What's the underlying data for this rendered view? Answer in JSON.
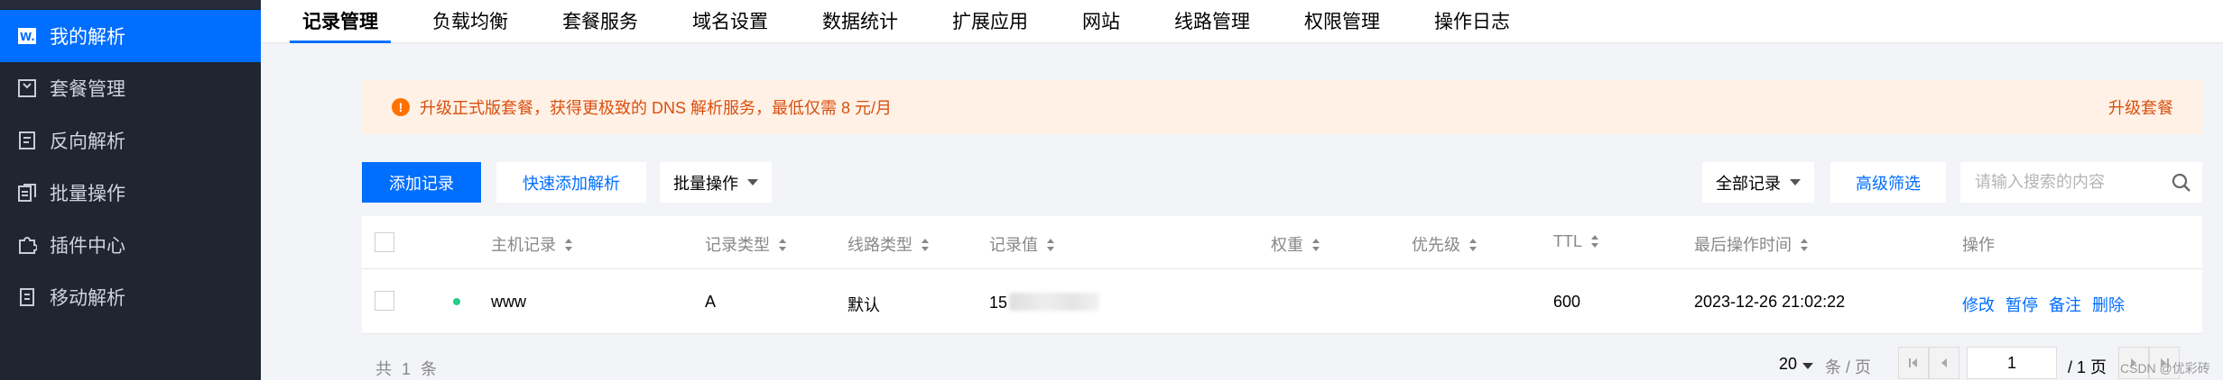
{
  "sidebar": {
    "items": [
      {
        "label": "我的解析",
        "icon": "dns-logo-icon",
        "active": true
      },
      {
        "label": "套餐管理",
        "icon": "package-icon",
        "active": false
      },
      {
        "label": "反向解析",
        "icon": "document-icon",
        "active": false
      },
      {
        "label": "批量操作",
        "icon": "stack-icon",
        "active": false
      },
      {
        "label": "插件中心",
        "icon": "puzzle-icon",
        "active": false
      },
      {
        "label": "移动解析",
        "icon": "mobile-doc-icon",
        "active": false
      }
    ]
  },
  "tabs": [
    "记录管理",
    "负载均衡",
    "套餐服务",
    "域名设置",
    "数据统计",
    "扩展应用",
    "网站",
    "线路管理",
    "权限管理",
    "操作日志"
  ],
  "alert": {
    "message": "升级正式版套餐，获得更极致的 DNS 解析服务，最低仅需 8 元/月",
    "action": "升级套餐",
    "icon": "warning-icon"
  },
  "toolbar": {
    "add_record": "添加记录",
    "quick_add": "快速添加解析",
    "batch": "批量操作",
    "filter_select": "全部记录",
    "advanced_filter": "高级筛选",
    "search_placeholder": "请输入搜索的内容"
  },
  "table": {
    "headers": {
      "host": "主机记录",
      "type": "记录类型",
      "line": "线路类型",
      "value": "记录值",
      "weight": "权重",
      "priority": "优先级",
      "ttl": "TTL",
      "last_modified": "最后操作时间",
      "actions": "操作"
    },
    "rows": [
      {
        "status": "enabled",
        "host": "www",
        "type": "A",
        "line": "默认",
        "value": "15",
        "weight": "",
        "priority": "",
        "ttl": "600",
        "last_modified": "2023-12-26 21:02:22",
        "actions": [
          "修改",
          "暂停",
          "备注",
          "删除"
        ]
      }
    ]
  },
  "footer": {
    "total": "共 1 条",
    "page_size": "20",
    "per_page": "条 / 页",
    "current_page": "1",
    "total_pages": "/ 1 页"
  },
  "watermark": "CSDN @优彩砖",
  "colors": {
    "accent": "#006eff",
    "sidebar_bg": "#1f2531",
    "alert_bg": "#fff1e6",
    "alert_text": "#d9500f",
    "status_green": "#29cc85"
  }
}
